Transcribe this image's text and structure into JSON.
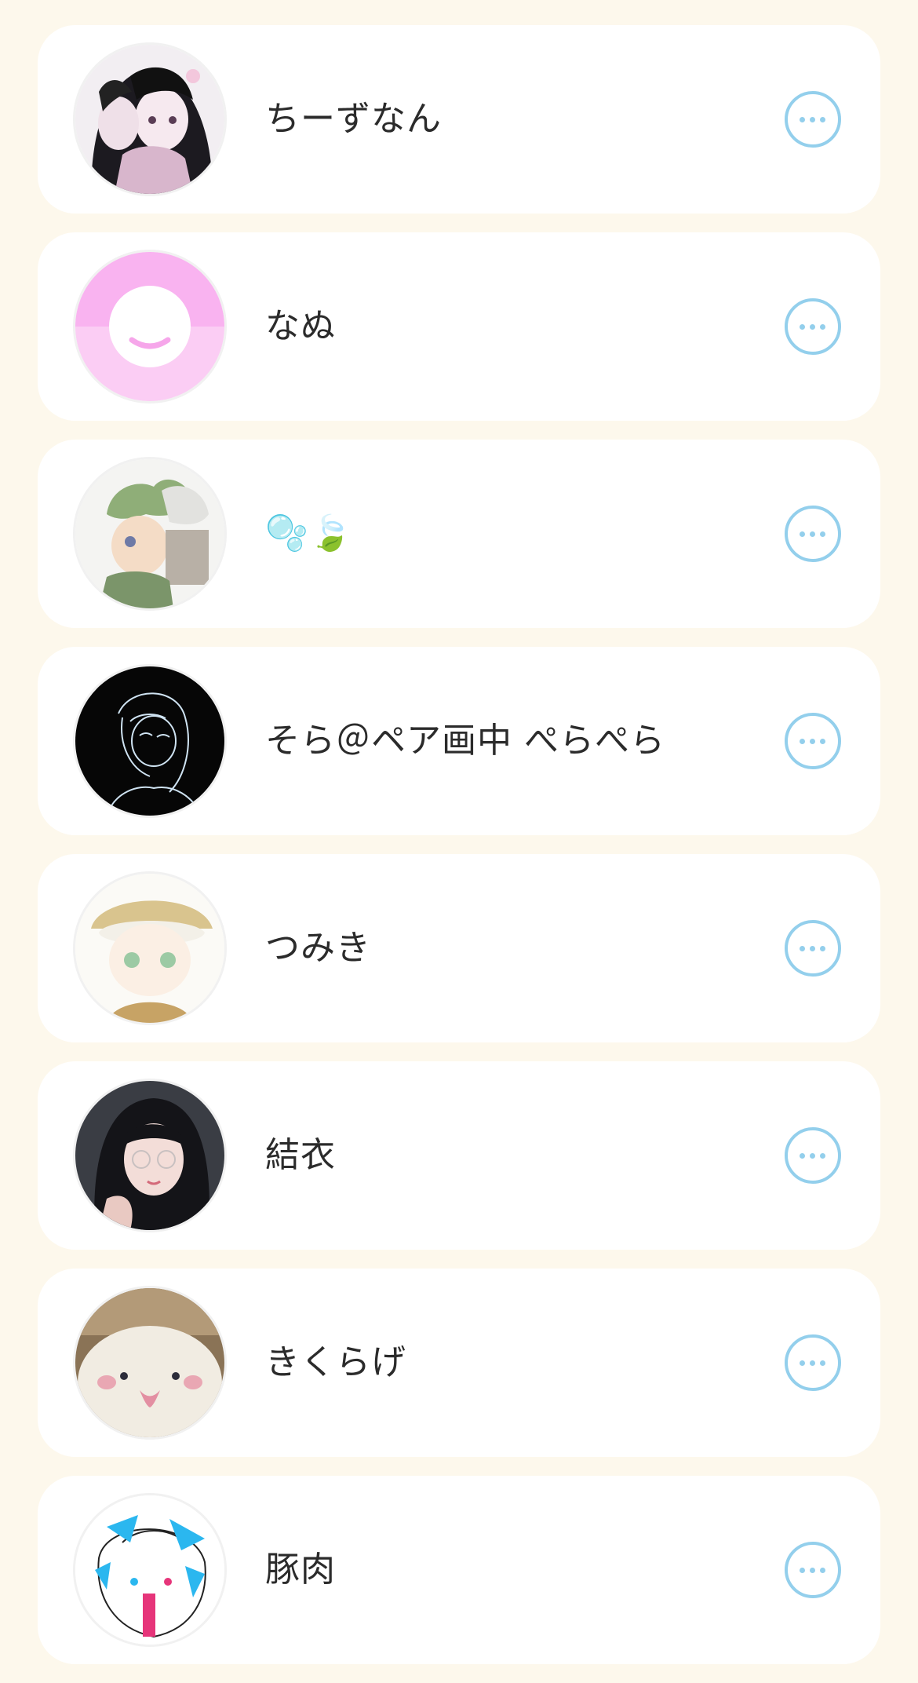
{
  "users": [
    {
      "name": "ちーずなん",
      "avatar": "avatar-anime-girls-icon"
    },
    {
      "name": "なぬ",
      "avatar": "avatar-default-smile-icon"
    },
    {
      "name": "🫧🍃",
      "avatar": "avatar-green-hair-character-icon"
    },
    {
      "name": "そら＠ペア画中 ぺらぺら",
      "avatar": "avatar-dark-line-art-icon"
    },
    {
      "name": "つみき",
      "avatar": "avatar-cap-boy-icon"
    },
    {
      "name": "結衣",
      "avatar": "avatar-glasses-girl-icon"
    },
    {
      "name": "きくらげ",
      "avatar": "avatar-plush-toy-icon"
    },
    {
      "name": "豚肉",
      "avatar": "avatar-doodle-icon"
    }
  ],
  "more_icon": "more-options-icon",
  "colors": {
    "background": "#fdf8ec",
    "card": "#ffffff",
    "accent": "#93cfec",
    "text": "#2b2b2b"
  }
}
